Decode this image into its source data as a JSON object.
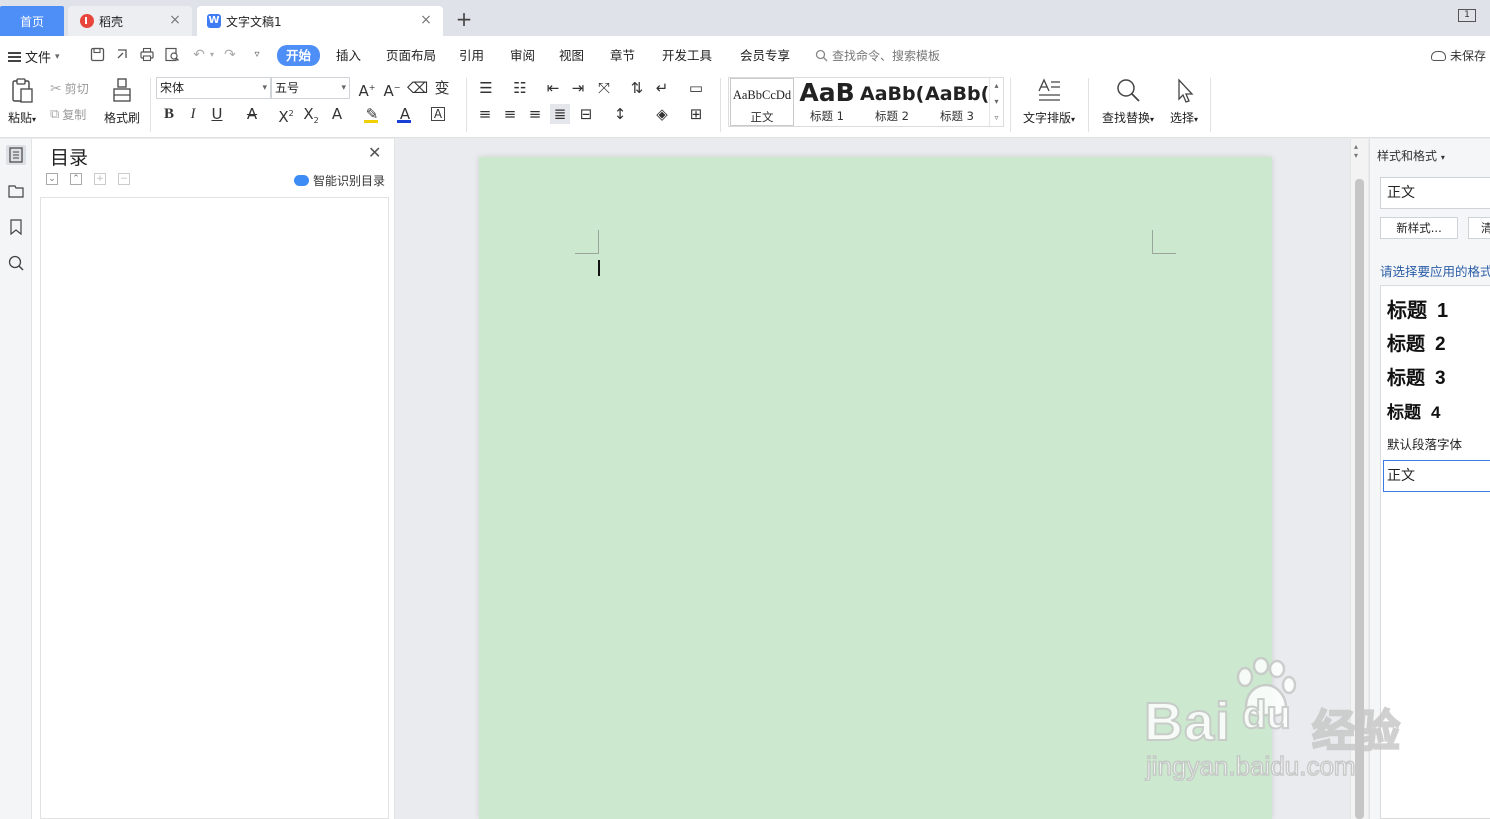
{
  "tabs": {
    "home": "首页",
    "daoke": "稻壳",
    "doc": "文字文稿1",
    "add": "+",
    "close": "×",
    "window_badge": "1"
  },
  "menu": {
    "file": "文件",
    "tabs": [
      "开始",
      "插入",
      "页面布局",
      "引用",
      "审阅",
      "视图",
      "章节",
      "开发工具",
      "会员专享"
    ],
    "active_tab": "开始",
    "search": "查找命令、搜索模板",
    "unsaved": "未保存"
  },
  "ribbon": {
    "paste": "粘贴",
    "cut": "剪切",
    "copy": "复制",
    "format_painter": "格式刷",
    "font_name": "宋体",
    "font_size": "五号",
    "styles": [
      {
        "preview": "AaBbCcDd",
        "label": "正文"
      },
      {
        "preview": "AaB",
        "label": "标题 1"
      },
      {
        "preview": "AaBb(",
        "label": "标题 2"
      },
      {
        "preview": "AaBb(",
        "label": "标题 3"
      }
    ],
    "text_layout": "文字排版",
    "find_replace": "查找替换",
    "select": "选择"
  },
  "toc": {
    "title": "目录",
    "smart": "智能识别目录"
  },
  "styles_panel": {
    "header": "样式和格式",
    "current": "正文",
    "new_style": "新样式...",
    "clear": "清",
    "prompt": "请选择要应用的格式",
    "items": [
      {
        "label": "标题",
        "num": "1"
      },
      {
        "label": "标题",
        "num": "2"
      },
      {
        "label": "标题",
        "num": "3"
      },
      {
        "label": "标题",
        "num": "4"
      }
    ],
    "default_font": "默认段落字体",
    "selected": "正文"
  },
  "watermark": {
    "brand": "Bai",
    "brand2": "du",
    "cn": "经验",
    "url": "jingyan.baidu.com"
  },
  "colors": {
    "accent": "#4e8ef7",
    "page_bg": "#cce8cf",
    "font_color_bar": "#1a3fd6",
    "highlight_bar": "#f0d000"
  }
}
